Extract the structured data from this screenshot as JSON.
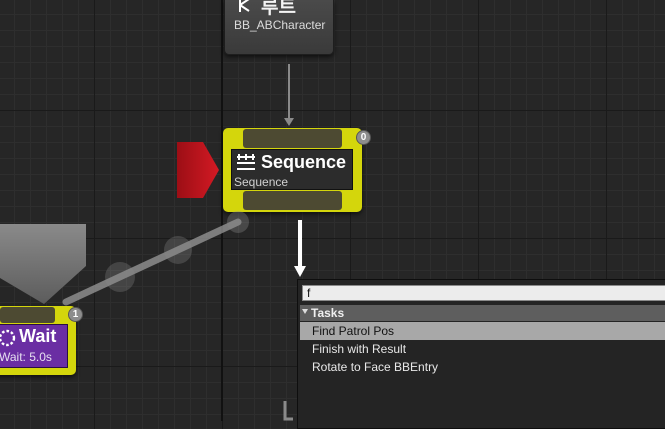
{
  "root_node": {
    "title": "루트",
    "subtitle": "BB_ABCharacter"
  },
  "sequence_node": {
    "title": "Sequence",
    "subtitle": "Sequence",
    "badge": "0"
  },
  "wait_node": {
    "title": "Wait",
    "subtitle": "Wait: 5.0s",
    "badge": "1"
  },
  "context_menu": {
    "search_value": "f",
    "category": "Tasks",
    "items": [
      {
        "label": "Find Patrol Pos",
        "selected": true
      },
      {
        "label": "Finish with Result",
        "selected": false
      },
      {
        "label": "Rotate to Face BBEntry",
        "selected": false
      }
    ]
  },
  "colors": {
    "graph_background": "#262626",
    "node_selected_border": "#d4d60c",
    "task_node": "#6a2ea3",
    "marker_red": "#c8141e",
    "menu_highlight": "#a8a8a8"
  },
  "icons": {
    "root": "root-branch-icon",
    "sequence": "sequence-icon",
    "wait": "wait-spinner-icon"
  }
}
